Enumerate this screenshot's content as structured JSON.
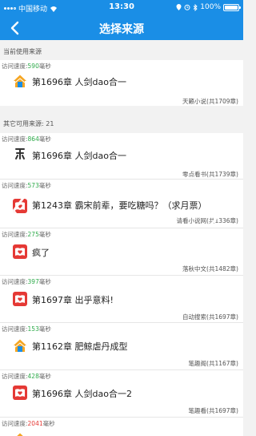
{
  "status_bar": {
    "carrier": "中国移动",
    "time": "13:30",
    "battery": "100%",
    "battery_level": 1.0
  },
  "nav": {
    "title": "选择来源"
  },
  "current_header": "当前使用来源",
  "other_header": "其它可用来源: 21",
  "speed_prefix": "访问速度:",
  "speed_unit": "毫秒",
  "current": {
    "speed": "590",
    "chapter": "第1696章 人剑dao合一",
    "source": "天籁小说(共1709章)",
    "icon": "house-icon"
  },
  "others": [
    {
      "speed": "864",
      "chapter": "第1696章 人剑dao合一",
      "source": "零点看书(共1739章)",
      "icon": "bookmark-icon"
    },
    {
      "speed": "573",
      "chapter": "第1243章 霸宋前辈，要吃糖吗？（求月票）",
      "source": "请看小说网(共1336章)",
      "icon": "book-heart-icon"
    },
    {
      "speed": "275",
      "chapter": "疯了",
      "source": "落秋中文(共1482章)",
      "icon": "book-heart-icon"
    },
    {
      "speed": "397",
      "chapter": "第1697章 出乎意料!",
      "source": "自动搜索(共1697章)",
      "icon": "book-heart-icon"
    },
    {
      "speed": "153",
      "chapter": "第1162章 肥鲸虐丹成型",
      "source": "笔趣阁(共1167章)",
      "icon": "house-icon"
    },
    {
      "speed": "428",
      "chapter": "第1696章 人剑dao合一2",
      "source": "笔趣看(共1697章)",
      "icon": "book-heart-icon"
    },
    {
      "speed": "2041",
      "chapter": "",
      "source": "",
      "icon": "house-icon"
    }
  ],
  "colors": {
    "primary": "#1a8ee6",
    "speed_green": "#2eaa4a",
    "speed_red": "#e53935",
    "icon_red": "#e53935",
    "icon_orange": "#f5a623"
  }
}
